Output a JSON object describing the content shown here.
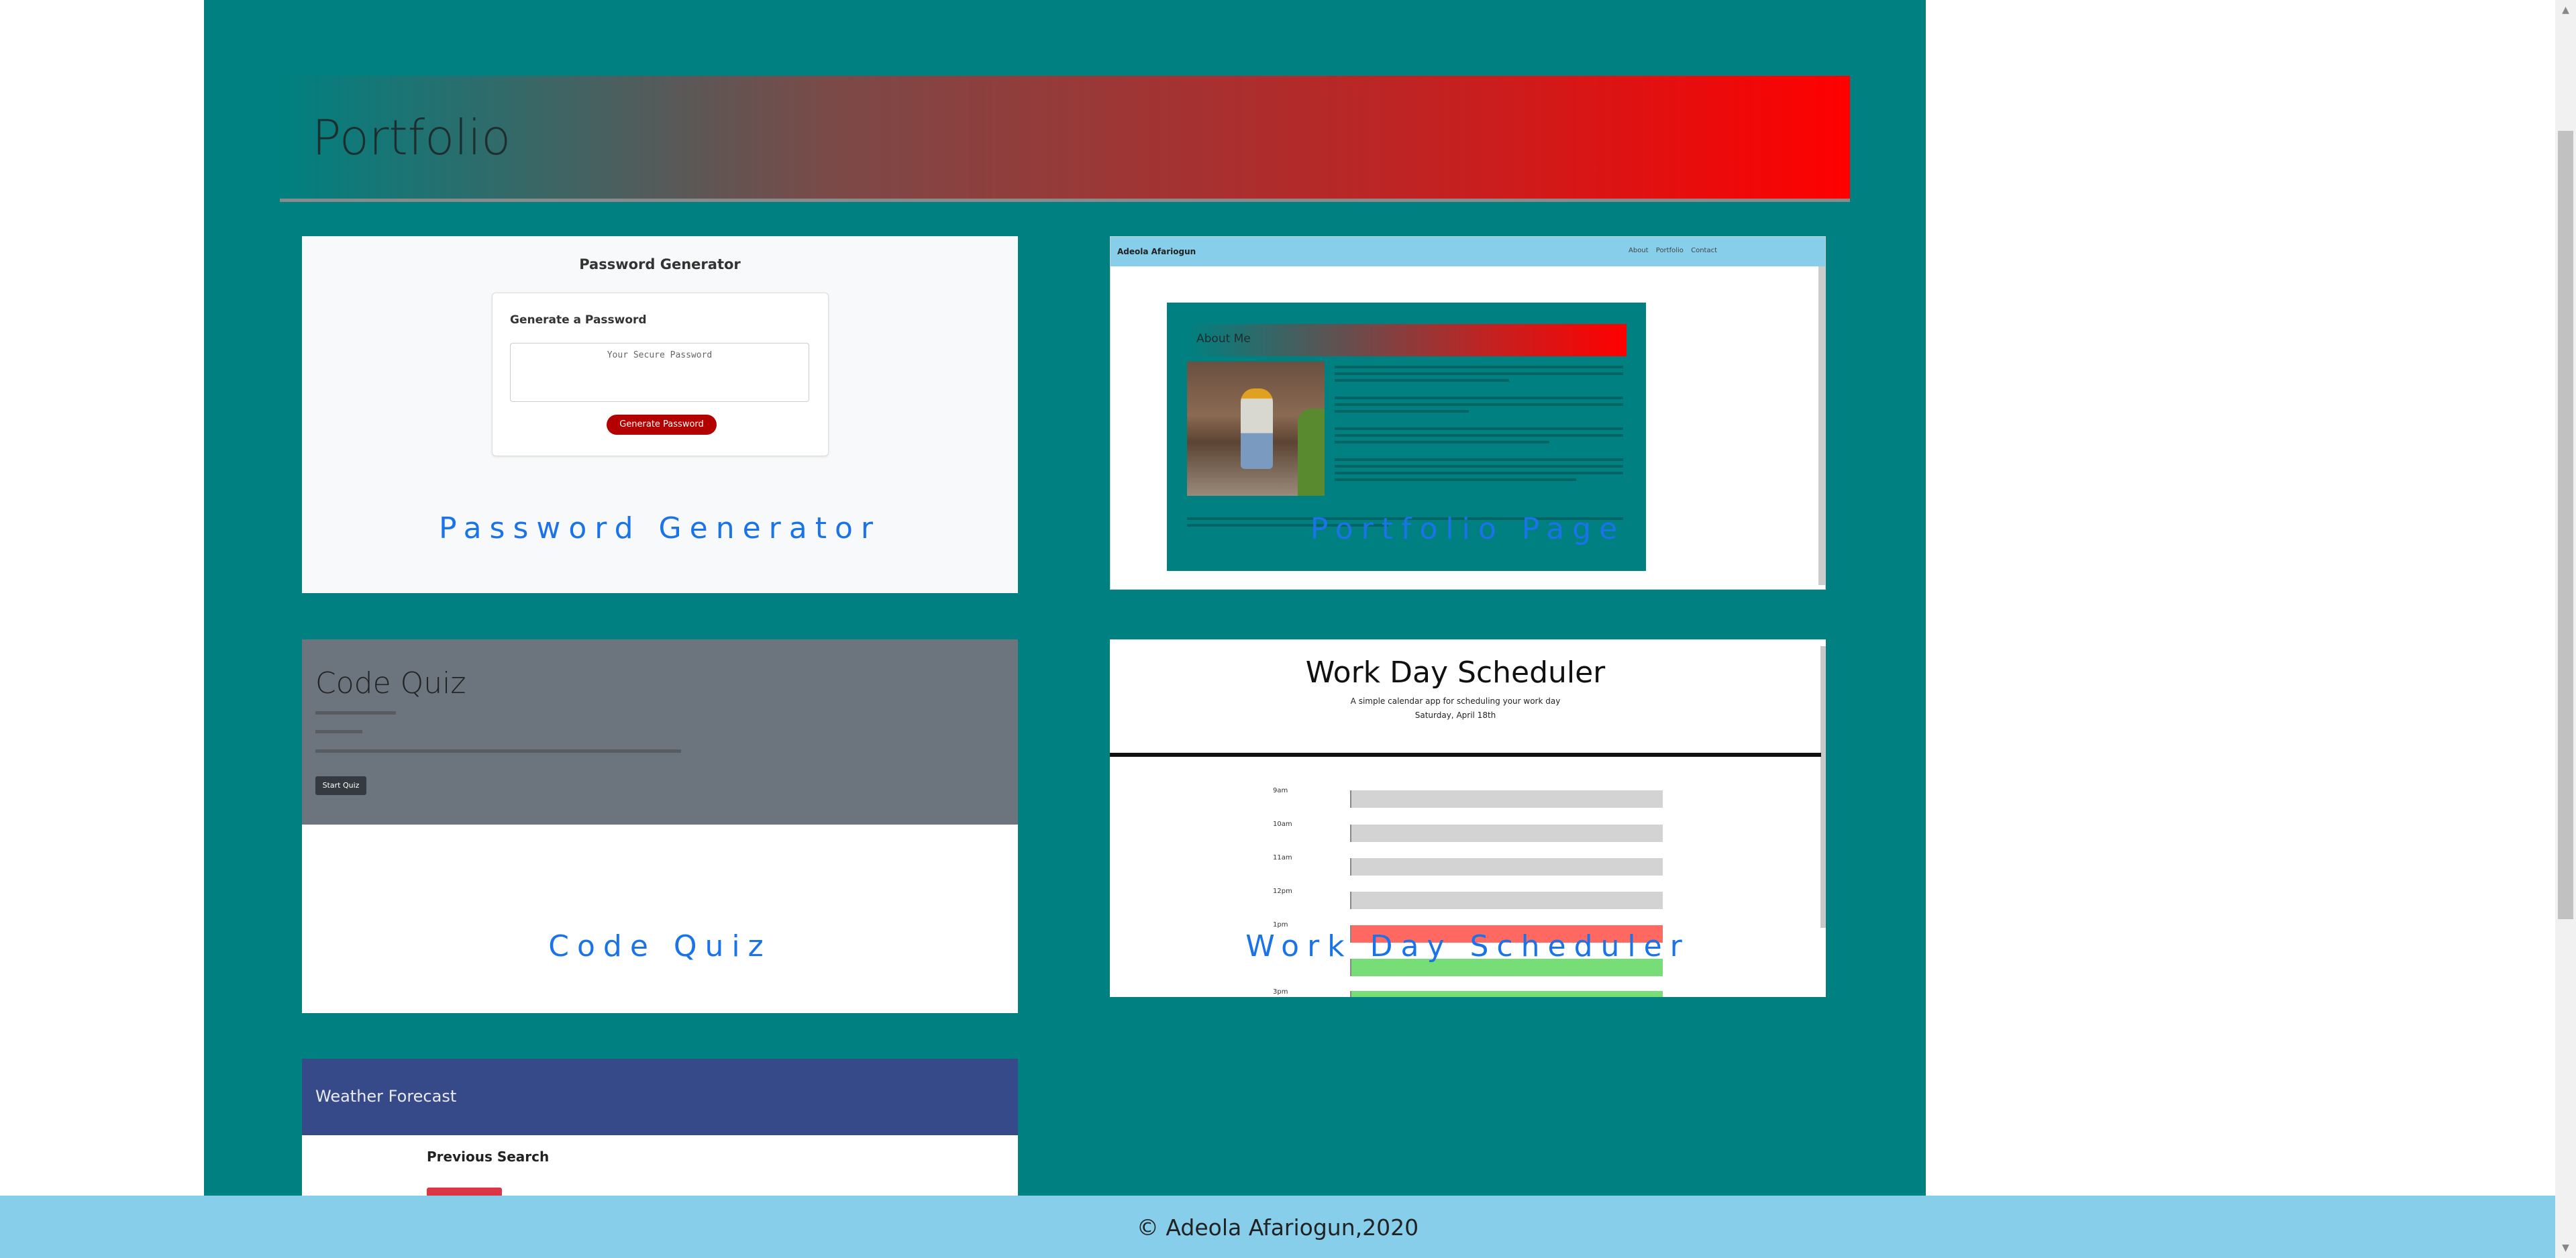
{
  "header": {
    "title": "Portfolio"
  },
  "cards": {
    "password": {
      "label": "Password Generator",
      "preview": {
        "title": "Password Generator",
        "box_title": "Generate a Password",
        "placeholder": "Your Secure Password",
        "button": "Generate Password"
      }
    },
    "portfolio": {
      "label": "Portfolio Page",
      "preview": {
        "name": "Adeola Afariogun",
        "nav": [
          "About",
          "Portfolio",
          "Contact"
        ],
        "section_title": "About Me"
      }
    },
    "quiz": {
      "label": "Code Quiz",
      "preview": {
        "title": "Code Quiz",
        "start_button": "Start Quiz"
      }
    },
    "scheduler": {
      "label": "Work Day Scheduler",
      "preview": {
        "title": "Work Day Scheduler",
        "subtitle": "A simple calendar app for scheduling your work day",
        "date": "Saturday, April 18th",
        "hours": [
          {
            "hour": "9am",
            "state": "past"
          },
          {
            "hour": "10am",
            "state": "past"
          },
          {
            "hour": "11am",
            "state": "past"
          },
          {
            "hour": "12pm",
            "state": "past"
          },
          {
            "hour": "1pm",
            "state": "present"
          },
          {
            "hour": "",
            "state": "future"
          },
          {
            "hour": "3pm",
            "state": "future"
          }
        ]
      }
    },
    "weather": {
      "preview": {
        "title": "Weather Forecast",
        "previous_search": "Previous Search"
      }
    }
  },
  "footer": {
    "text": "© Adeola Afariogun,2020"
  },
  "colors": {
    "panel": "#008080",
    "footer": "#87ceeb",
    "link": "#1a73e8",
    "past": "#d3d3d3",
    "present": "#ff6961",
    "future": "#77dd77"
  }
}
